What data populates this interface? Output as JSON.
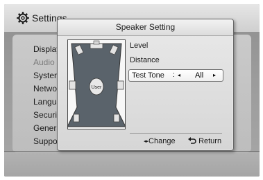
{
  "background": {
    "header_title": "Settings",
    "menu_items": [
      "Display",
      "Audio",
      "System",
      "Network",
      "Language",
      "Security",
      "General",
      "Support"
    ],
    "active_item": "Audio"
  },
  "popup": {
    "title": "Speaker Setting",
    "diagram_label": "User",
    "options": {
      "level": "Level",
      "distance": "Distance",
      "test_tone": {
        "label": "Test Tone",
        "separator": ":",
        "value": "All",
        "left_arrow": "◂",
        "right_arrow": "▸"
      }
    },
    "footer": {
      "change_arrows": "◂▸",
      "change_label": "Change",
      "return_label": "Return"
    }
  }
}
